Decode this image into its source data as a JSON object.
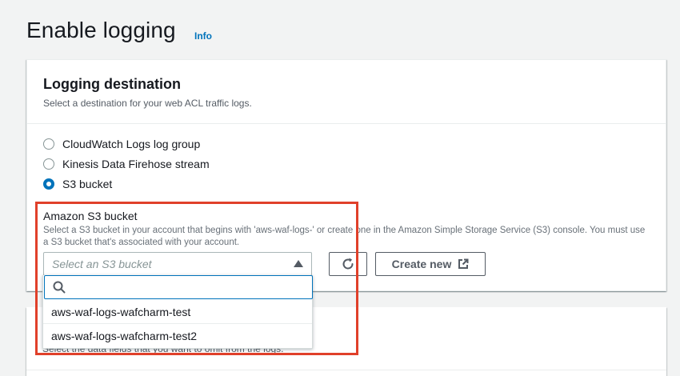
{
  "page": {
    "title": "Enable logging",
    "info_label": "Info"
  },
  "logging_destination": {
    "title": "Logging destination",
    "description": "Select a destination for your web ACL traffic logs.",
    "options": [
      {
        "label": "CloudWatch Logs log group",
        "selected": false
      },
      {
        "label": "Kinesis Data Firehose stream",
        "selected": false
      },
      {
        "label": "S3 bucket",
        "selected": true
      }
    ]
  },
  "s3_bucket": {
    "label": "Amazon S3 bucket",
    "description": "Select a S3 bucket in your account that begins with 'aws-waf-logs-' or create one in the Amazon Simple Storage Service (S3) console. You must use a S3 bucket that's associated with your account.",
    "placeholder": "Select an S3 bucket",
    "search_value": "",
    "options": [
      "aws-waf-logs-wafcharm-test",
      "aws-waf-logs-wafcharm-test2"
    ],
    "create_label": "Create new"
  },
  "redacted_fields": {
    "description": "Select the data fields that you want to omit from the logs."
  },
  "colors": {
    "accent": "#0073bb",
    "highlight": "#e0402a"
  }
}
